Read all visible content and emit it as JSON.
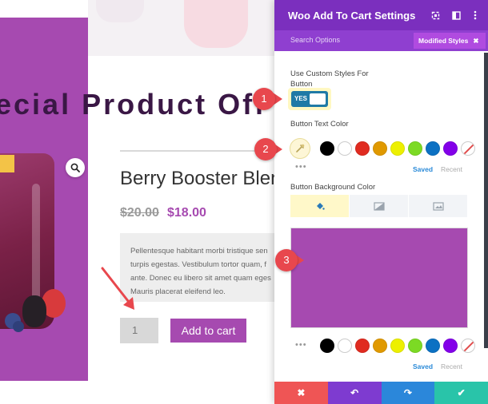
{
  "page": {
    "hero_title": "ecial Product Off",
    "product_title": "Berry Booster Blend",
    "price_old": "$20.00",
    "price_new": "$18.00",
    "description_lines": [
      "Pellentesque habitant morbi tristique sen",
      "turpis egestas. Vestibulum tortor quam, f",
      "ante. Donec eu libero sit amet quam eges",
      "Mauris placerat eleifend leo."
    ],
    "quantity": "1",
    "add_to_cart_label": "Add to cart",
    "zoom_icon": "search-icon"
  },
  "panel": {
    "title": "Woo Add To Cart Settings",
    "search_options": "Search Options",
    "modified_styles": "Modified Styles",
    "custom_styles_label": "Use Custom Styles For Button",
    "toggle_text": "YES",
    "text_color_label": "Button Text Color",
    "bg_color_label": "Button Background Color",
    "saved_label": "Saved",
    "recent_label": "Recent",
    "footer": {
      "cancel": "✖",
      "undo": "↶",
      "redo": "↷",
      "save": "✔"
    },
    "swatch_colors": [
      "#000000",
      "#ffffff",
      "#e02b20",
      "#e09900",
      "#edf000",
      "#7cda24",
      "#0c71c3",
      "#8300e9"
    ],
    "background_color": "#a64ab0"
  },
  "annotations": {
    "badge_1": "1",
    "badge_2": "2",
    "badge_3": "3"
  },
  "colors": {
    "accent_purple": "#a64ab0",
    "header_purple": "#7b2fbe",
    "tab_purple": "#8f3fd0",
    "badge_red": "#e8474d"
  }
}
